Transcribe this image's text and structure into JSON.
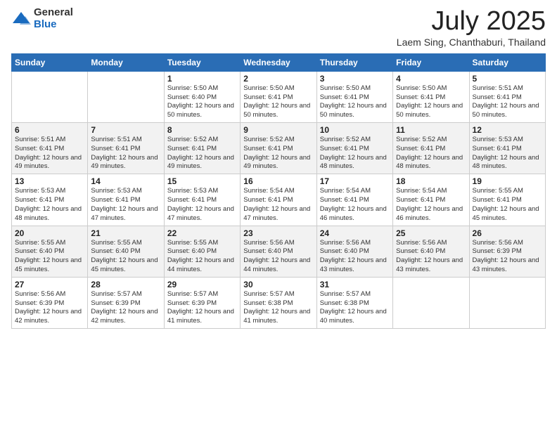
{
  "header": {
    "logo_general": "General",
    "logo_blue": "Blue",
    "title": "July 2025",
    "subtitle": "Laem Sing, Chanthaburi, Thailand"
  },
  "days_of_week": [
    "Sunday",
    "Monday",
    "Tuesday",
    "Wednesday",
    "Thursday",
    "Friday",
    "Saturday"
  ],
  "weeks": [
    [
      {
        "day": "",
        "info": ""
      },
      {
        "day": "",
        "info": ""
      },
      {
        "day": "1",
        "info": "Sunrise: 5:50 AM\nSunset: 6:40 PM\nDaylight: 12 hours and 50 minutes."
      },
      {
        "day": "2",
        "info": "Sunrise: 5:50 AM\nSunset: 6:41 PM\nDaylight: 12 hours and 50 minutes."
      },
      {
        "day": "3",
        "info": "Sunrise: 5:50 AM\nSunset: 6:41 PM\nDaylight: 12 hours and 50 minutes."
      },
      {
        "day": "4",
        "info": "Sunrise: 5:50 AM\nSunset: 6:41 PM\nDaylight: 12 hours and 50 minutes."
      },
      {
        "day": "5",
        "info": "Sunrise: 5:51 AM\nSunset: 6:41 PM\nDaylight: 12 hours and 50 minutes."
      }
    ],
    [
      {
        "day": "6",
        "info": "Sunrise: 5:51 AM\nSunset: 6:41 PM\nDaylight: 12 hours and 49 minutes."
      },
      {
        "day": "7",
        "info": "Sunrise: 5:51 AM\nSunset: 6:41 PM\nDaylight: 12 hours and 49 minutes."
      },
      {
        "day": "8",
        "info": "Sunrise: 5:52 AM\nSunset: 6:41 PM\nDaylight: 12 hours and 49 minutes."
      },
      {
        "day": "9",
        "info": "Sunrise: 5:52 AM\nSunset: 6:41 PM\nDaylight: 12 hours and 49 minutes."
      },
      {
        "day": "10",
        "info": "Sunrise: 5:52 AM\nSunset: 6:41 PM\nDaylight: 12 hours and 48 minutes."
      },
      {
        "day": "11",
        "info": "Sunrise: 5:52 AM\nSunset: 6:41 PM\nDaylight: 12 hours and 48 minutes."
      },
      {
        "day": "12",
        "info": "Sunrise: 5:53 AM\nSunset: 6:41 PM\nDaylight: 12 hours and 48 minutes."
      }
    ],
    [
      {
        "day": "13",
        "info": "Sunrise: 5:53 AM\nSunset: 6:41 PM\nDaylight: 12 hours and 48 minutes."
      },
      {
        "day": "14",
        "info": "Sunrise: 5:53 AM\nSunset: 6:41 PM\nDaylight: 12 hours and 47 minutes."
      },
      {
        "day": "15",
        "info": "Sunrise: 5:53 AM\nSunset: 6:41 PM\nDaylight: 12 hours and 47 minutes."
      },
      {
        "day": "16",
        "info": "Sunrise: 5:54 AM\nSunset: 6:41 PM\nDaylight: 12 hours and 47 minutes."
      },
      {
        "day": "17",
        "info": "Sunrise: 5:54 AM\nSunset: 6:41 PM\nDaylight: 12 hours and 46 minutes."
      },
      {
        "day": "18",
        "info": "Sunrise: 5:54 AM\nSunset: 6:41 PM\nDaylight: 12 hours and 46 minutes."
      },
      {
        "day": "19",
        "info": "Sunrise: 5:55 AM\nSunset: 6:41 PM\nDaylight: 12 hours and 45 minutes."
      }
    ],
    [
      {
        "day": "20",
        "info": "Sunrise: 5:55 AM\nSunset: 6:40 PM\nDaylight: 12 hours and 45 minutes."
      },
      {
        "day": "21",
        "info": "Sunrise: 5:55 AM\nSunset: 6:40 PM\nDaylight: 12 hours and 45 minutes."
      },
      {
        "day": "22",
        "info": "Sunrise: 5:55 AM\nSunset: 6:40 PM\nDaylight: 12 hours and 44 minutes."
      },
      {
        "day": "23",
        "info": "Sunrise: 5:56 AM\nSunset: 6:40 PM\nDaylight: 12 hours and 44 minutes."
      },
      {
        "day": "24",
        "info": "Sunrise: 5:56 AM\nSunset: 6:40 PM\nDaylight: 12 hours and 43 minutes."
      },
      {
        "day": "25",
        "info": "Sunrise: 5:56 AM\nSunset: 6:40 PM\nDaylight: 12 hours and 43 minutes."
      },
      {
        "day": "26",
        "info": "Sunrise: 5:56 AM\nSunset: 6:39 PM\nDaylight: 12 hours and 43 minutes."
      }
    ],
    [
      {
        "day": "27",
        "info": "Sunrise: 5:56 AM\nSunset: 6:39 PM\nDaylight: 12 hours and 42 minutes."
      },
      {
        "day": "28",
        "info": "Sunrise: 5:57 AM\nSunset: 6:39 PM\nDaylight: 12 hours and 42 minutes."
      },
      {
        "day": "29",
        "info": "Sunrise: 5:57 AM\nSunset: 6:39 PM\nDaylight: 12 hours and 41 minutes."
      },
      {
        "day": "30",
        "info": "Sunrise: 5:57 AM\nSunset: 6:38 PM\nDaylight: 12 hours and 41 minutes."
      },
      {
        "day": "31",
        "info": "Sunrise: 5:57 AM\nSunset: 6:38 PM\nDaylight: 12 hours and 40 minutes."
      },
      {
        "day": "",
        "info": ""
      },
      {
        "day": "",
        "info": ""
      }
    ]
  ]
}
